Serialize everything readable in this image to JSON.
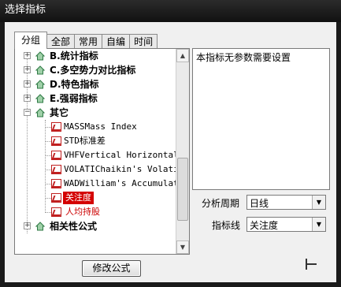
{
  "window": {
    "title": "选择指标"
  },
  "tabs": [
    {
      "label": "分组",
      "active": true
    },
    {
      "label": "全部",
      "active": false
    },
    {
      "label": "常用",
      "active": false
    },
    {
      "label": "自编",
      "active": false
    },
    {
      "label": "时间",
      "active": false
    }
  ],
  "tree": {
    "categories": [
      {
        "prefix": "B.",
        "label": "统计指标",
        "expanded": false
      },
      {
        "prefix": "C.",
        "label": "多空势力对比指标",
        "expanded": false
      },
      {
        "prefix": "D.",
        "label": "特色指标",
        "expanded": false
      },
      {
        "prefix": "E.",
        "label": "强弱指标",
        "expanded": false
      },
      {
        "prefix": "",
        "label": "其它",
        "expanded": true
      },
      {
        "prefix": "",
        "label": "相关性公式",
        "expanded": false
      }
    ],
    "items": [
      {
        "label": "MASSMass Index",
        "color": "#000000",
        "selected": false
      },
      {
        "label": "STD标准差",
        "color": "#000000",
        "selected": false
      },
      {
        "label": "VHFVertical Horizontal F",
        "color": "#000000",
        "selected": false
      },
      {
        "label": "VOLATIChaikin's Volatili",
        "color": "#000000",
        "selected": false
      },
      {
        "label": "WADWilliam's Accumulati",
        "color": "#000000",
        "selected": false
      },
      {
        "label": "关注度",
        "color": "#ffffff",
        "selected": true
      },
      {
        "label": "人均持股",
        "color": "#cc0000",
        "selected": false
      }
    ],
    "expander_collapsed": "+",
    "expander_expanded": "−",
    "selection_color": "#d40000"
  },
  "description": {
    "text": "本指标无参数需要设置"
  },
  "params": {
    "period_label": "分析周期",
    "period_value": "日线",
    "indicator_label": "指标线",
    "indicator_value": "关注度"
  },
  "buttons": {
    "edit_formula": "修改公式"
  },
  "icons": {
    "category": "house-icon",
    "item": "formula-icon",
    "combo": "chevron-down-icon",
    "scroll_up": "arrow-up-icon",
    "scroll_down": "arrow-down-icon"
  }
}
